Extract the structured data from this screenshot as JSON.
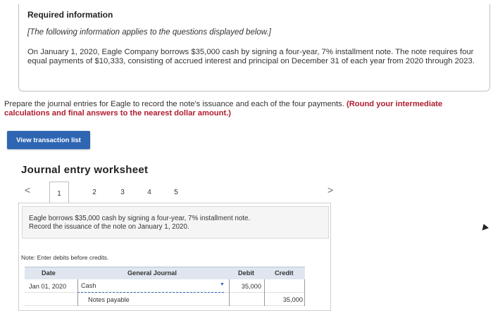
{
  "info": {
    "title": "Required information",
    "subtitle": "[The following information applies to the questions displayed below.]",
    "body": "On January 1, 2020, Eagle Company borrows $35,000 cash by signing a four-year, 7% installment note. The note requires four equal payments of $10,333, consisting of accrued interest and principal on December 31 of each year from 2020 through 2023."
  },
  "instructions": {
    "text": "Prepare the journal entries for Eagle to record the note's issuance and each of the four payments. ",
    "emphasis": "(Round your intermediate calculations and final answers to the nearest dollar amount.)"
  },
  "view_button": "View transaction list",
  "worksheet": {
    "title": "Journal entry worksheet",
    "left_arrow": "<",
    "right_arrow": ">",
    "tabs": [
      "1",
      "2",
      "3",
      "4",
      "5"
    ],
    "description_line1": "Eagle borrows $35,000 cash by signing a four-year, 7% installment note.",
    "description_line2": "Record the issuance of the note on January 1, 2020.",
    "note": "Note: Enter debits before credits.",
    "table": {
      "headers": {
        "date": "Date",
        "journal": "General Journal",
        "debit": "Debit",
        "credit": "Credit"
      },
      "rows": [
        {
          "date": "Jan 01, 2020",
          "account": "Cash",
          "debit": "35,000",
          "credit": ""
        },
        {
          "date": "",
          "account": "Notes payable",
          "debit": "",
          "credit": "35,000"
        }
      ]
    }
  }
}
